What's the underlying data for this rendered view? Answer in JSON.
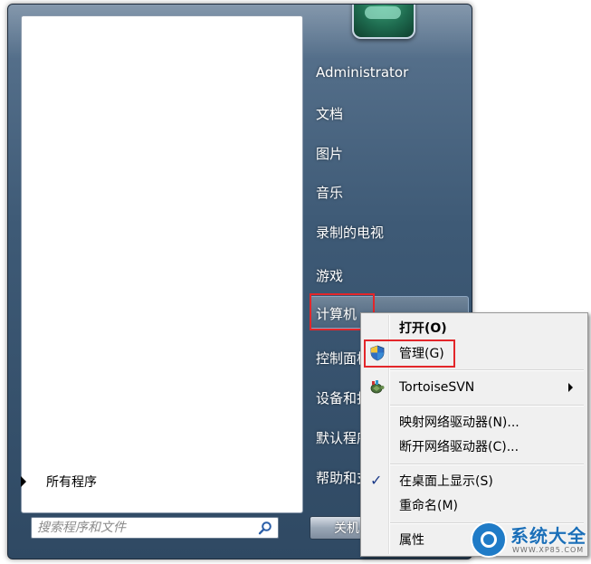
{
  "start_menu": {
    "all_programs_label": "所有程序",
    "search_placeholder": "搜索程序和文件",
    "right_items": {
      "user": "Administrator",
      "documents": "文档",
      "pictures": "图片",
      "music": "音乐",
      "recorded_tv": "录制的电视",
      "games": "游戏",
      "computer": "计算机",
      "control_panel": "控制面板",
      "devices_printers": "设备和打",
      "default_programs": "默认程序",
      "help_support": "帮助和支"
    },
    "shutdown_label": "关机"
  },
  "context_menu": {
    "items": {
      "open": "打开(O)",
      "manage": "管理(G)",
      "tortoisesvn": "TortoiseSVN",
      "map_drive": "映射网络驱动器(N)...",
      "disconnect_drive": "断开网络驱动器(C)...",
      "show_on_desktop": "在桌面上显示(S)",
      "rename": "重命名(M)",
      "properties": "属性"
    }
  },
  "watermark": {
    "title": "系统大全",
    "url": "WWW.XP85.COM"
  },
  "colors": {
    "highlight_red": "#e3262a",
    "menu_blue": "#3e5a76"
  }
}
